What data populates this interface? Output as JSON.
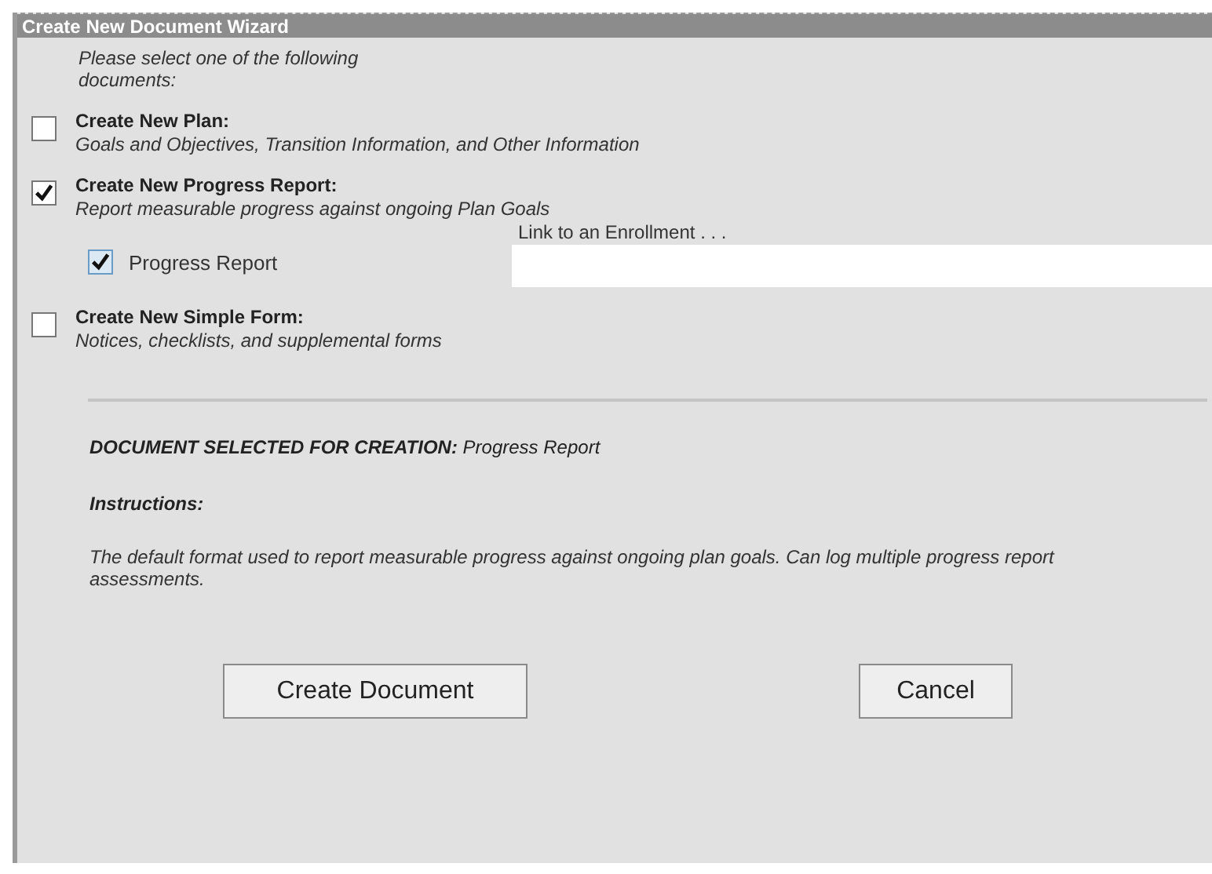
{
  "window": {
    "title": "Create New Document Wizard"
  },
  "prompt": "Please select one of the following documents:",
  "options": [
    {
      "title": "Create New Plan:",
      "description": "Goals and Objectives, Transition Information, and Other Information",
      "checked": false
    },
    {
      "title": "Create New Progress Report:",
      "description": "Report measurable progress against ongoing Plan Goals",
      "checked": true,
      "sub_option": {
        "label": "Progress Report",
        "checked": true
      },
      "enrollment": {
        "label": "Link to an Enrollment . . ."
      }
    },
    {
      "title": "Create New Simple Form:",
      "description": "Notices, checklists, and supplemental forms",
      "checked": false
    }
  ],
  "selected_document": "**DOCUMENT SELECTED FOR CREATION:** Progress Report",
  "instructions_heading": "Instructions:",
  "instructions": "The default format used to report measurable progress against ongoing plan goals. Can log multiple progress report assessments.",
  "buttons": [
    {
      "label": "Create Document"
    },
    {
      "label": "Cancel"
    }
  ]
}
